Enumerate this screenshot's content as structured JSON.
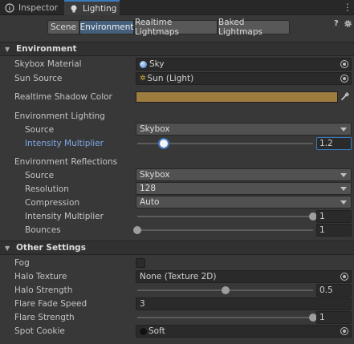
{
  "tabs": [
    {
      "label": "Inspector",
      "icon": "info-icon"
    },
    {
      "label": "Lighting",
      "icon": "lightbulb-icon"
    }
  ],
  "toolbar": {
    "segments": [
      "Scene",
      "Environment",
      "Realtime Lightmaps",
      "Baked Lightmaps"
    ],
    "selected": "Environment"
  },
  "environment": {
    "header": "Environment",
    "skybox_material": {
      "label": "Skybox Material",
      "value": "Sky"
    },
    "sun_source": {
      "label": "Sun Source",
      "value": "Sun (Light)"
    },
    "shadow_color": {
      "label": "Realtime Shadow Color",
      "color": "#9e7b3e"
    },
    "lighting": {
      "heading": "Environment Lighting",
      "source": {
        "label": "Source",
        "value": "Skybox"
      },
      "intensity": {
        "label": "Intensity Multiplier",
        "value": "1.2",
        "fraction": 0.15
      }
    },
    "reflections": {
      "heading": "Environment Reflections",
      "source": {
        "label": "Source",
        "value": "Skybox"
      },
      "resolution": {
        "label": "Resolution",
        "value": "128"
      },
      "compression": {
        "label": "Compression",
        "value": "Auto"
      },
      "intensity": {
        "label": "Intensity Multiplier",
        "value": "1",
        "fraction": 1.0
      },
      "bounces": {
        "label": "Bounces",
        "value": "1",
        "fraction": 0.0
      }
    }
  },
  "other": {
    "header": "Other Settings",
    "fog": {
      "label": "Fog",
      "checked": false
    },
    "halo_texture": {
      "label": "Halo Texture",
      "value": "None (Texture 2D)"
    },
    "halo_strength": {
      "label": "Halo Strength",
      "value": "0.5",
      "fraction": 0.5
    },
    "flare_fade": {
      "label": "Flare Fade Speed",
      "value": "3"
    },
    "flare_strength": {
      "label": "Flare Strength",
      "value": "1",
      "fraction": 1.0
    },
    "spot_cookie": {
      "label": "Spot Cookie",
      "value": "Soft"
    }
  },
  "colors": {
    "accent": "#3a79bb",
    "selected_segment": "#46607c"
  }
}
